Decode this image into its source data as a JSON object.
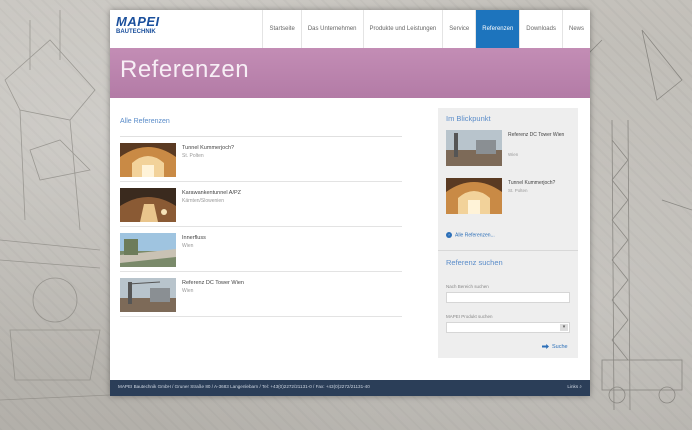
{
  "header": {
    "logo": {
      "brand": "MAPEI",
      "sub": "BAUTECHNIK"
    },
    "nav": [
      {
        "label": "Startseite",
        "active": false
      },
      {
        "label": "Das Unternehmen",
        "active": false
      },
      {
        "label": "Produkte und Leistungen",
        "active": false
      },
      {
        "label": "Service",
        "active": false
      },
      {
        "label": "Referenzen",
        "active": true
      },
      {
        "label": "Downloads",
        "active": false
      },
      {
        "label": "News",
        "active": false
      }
    ]
  },
  "banner": {
    "title": "Referenzen"
  },
  "main": {
    "section_title": "Alle Referenzen",
    "items": [
      {
        "title": "Tunnel Kummerjoch?",
        "place": "St. Polten"
      },
      {
        "title": "Karawankentunnel A/PZ",
        "place": "Kärnten/Slowenien"
      },
      {
        "title": "Innerfluss",
        "place": "Wien"
      },
      {
        "title": "Referenz DC Tower Wien",
        "place": "Wien"
      }
    ]
  },
  "sidebar": {
    "spotlight_title": "Im Blickpunkt",
    "spotlight": [
      {
        "title": "Referenz DC Tower Wien",
        "place": "Wien"
      },
      {
        "title": "Tunnel Kummerjoch?",
        "place": "St. Polten"
      }
    ],
    "all_link": "Alle Referenzen...",
    "search_title": "Referenz suchen",
    "field1_label": "Nach Bereich suchen",
    "field2_label": "MAPEI Produkt suchen",
    "search_button": "Suche"
  },
  "footer": {
    "text": "MAPEI Bautechnik GmbH / Gruner Straße 80 / A-3683 Langenlebarn / Tel: +43(0)2272/21131-0 / Fax: +43(0)2272/21131-40",
    "tools": "Links  ⌕"
  },
  "colors": {
    "brand_blue": "#1d74bd",
    "banner_purple": "#b37ba6",
    "footer_navy": "#2b3e58"
  }
}
